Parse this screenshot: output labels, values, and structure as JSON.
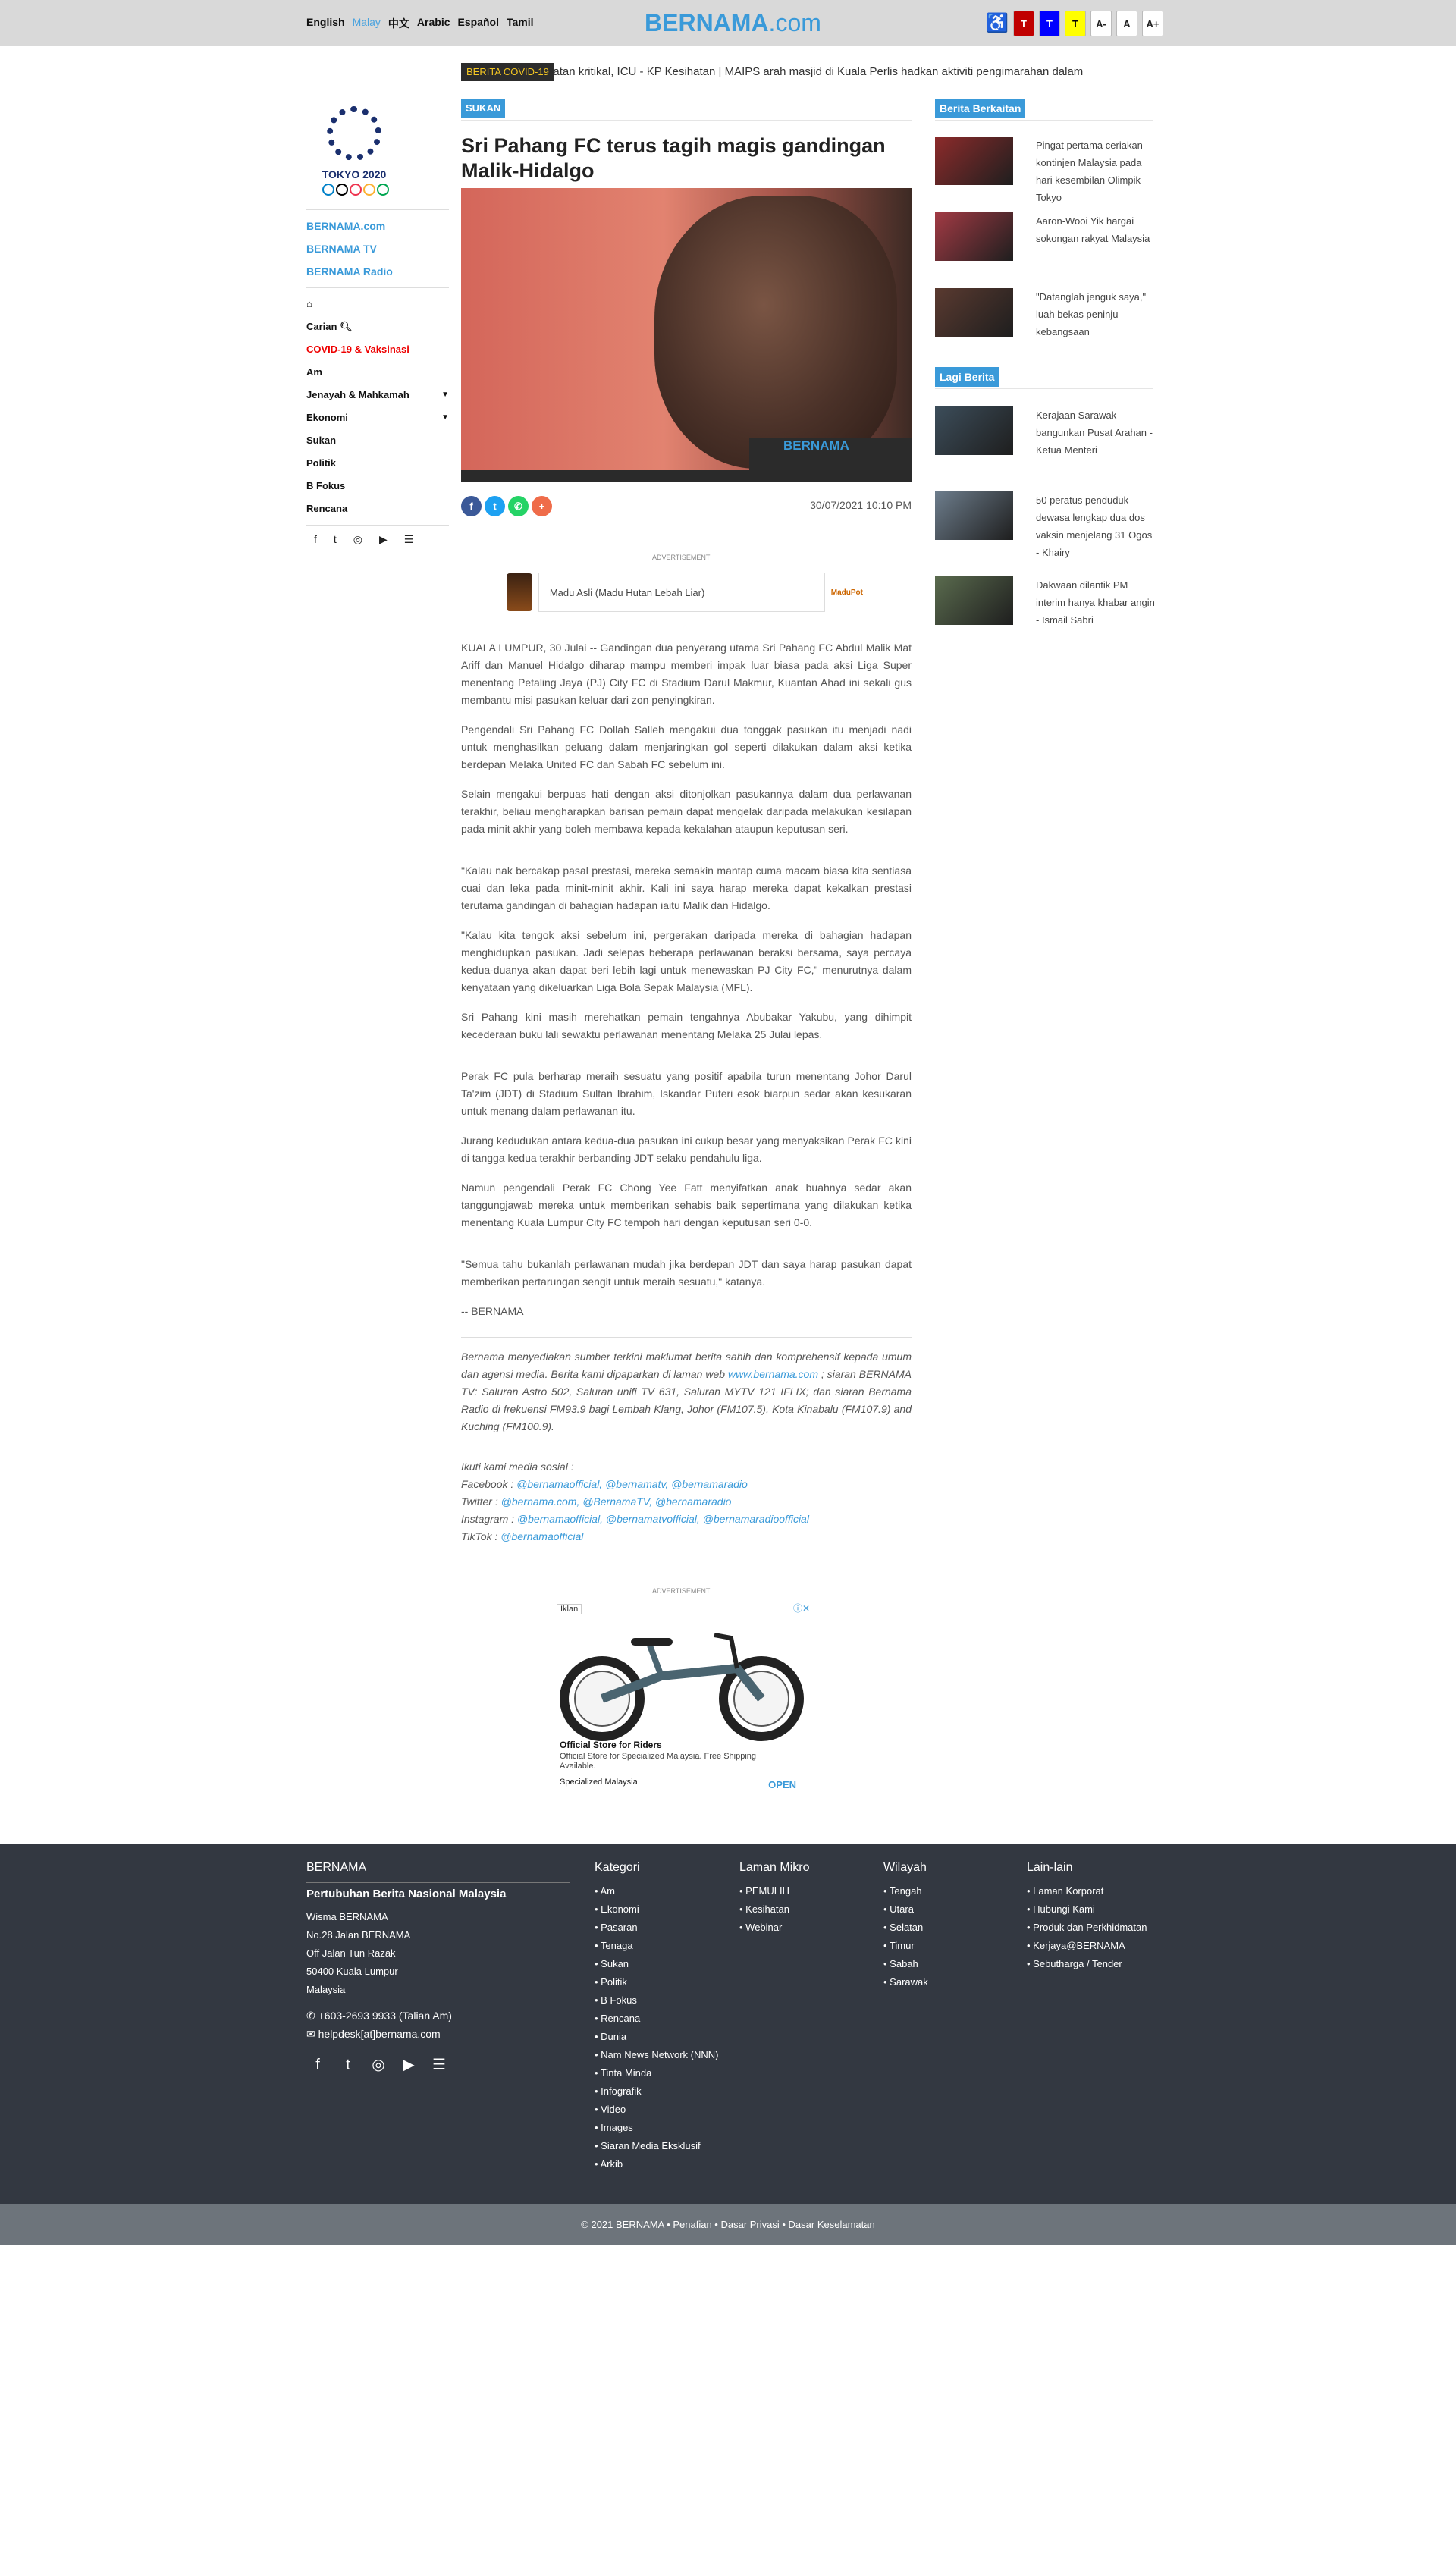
{
  "header": {
    "languages": [
      "English",
      "Malay",
      "中文",
      "Arabic",
      "Español",
      "Tamil"
    ],
    "active_language": "Malay",
    "logo_main": "BERNAMA",
    "logo_suffix": ".com",
    "accessibility_icon": "wheelchair-icon",
    "contrast_buttons": [
      "T",
      "T",
      "T"
    ],
    "contrast_colors": [
      "#c00000",
      "#0000ff",
      "#ffff00"
    ],
    "font_buttons": [
      "A-",
      "A",
      "A+"
    ]
  },
  "ticker": {
    "label": "BERITA COVID-19",
    "text": "erlu rawatan kritikal, ICU - KP Kesihatan  |  MAIPS arah masjid di Kuala Perlis hadkan aktiviti pengimarahan dalam"
  },
  "sidebar": {
    "logo_text": "TOKYO 2020",
    "links": [
      "BERNAMA.com",
      "BERNAMA TV",
      "BERNAMA Radio"
    ],
    "home_icon": "home-icon",
    "search_label": "Carian",
    "search_icon": "search-icon",
    "items": [
      {
        "label": "COVID-19 & Vaksinasi",
        "red": true,
        "caret": false
      },
      {
        "label": "Am",
        "caret": false
      },
      {
        "label": "Jenayah & Mahkamah",
        "caret": true
      },
      {
        "label": "Ekonomi",
        "caret": true
      },
      {
        "label": "Sukan",
        "caret": false
      },
      {
        "label": "Politik",
        "caret": false
      },
      {
        "label": "B Fokus",
        "caret": false
      },
      {
        "label": "Rencana",
        "caret": false
      }
    ],
    "social_icons": [
      "facebook-icon",
      "twitter-icon",
      "instagram-icon",
      "youtube-icon",
      "rss-icon"
    ]
  },
  "article": {
    "section": "SUKAN",
    "headline": "Sri Pahang FC terus tagih magis gandingan Malik-Hidalgo",
    "image_watermark": "BERNAMA",
    "datetime": "30/07/2021 10:10 PM",
    "share_icons": [
      "facebook-icon",
      "twitter-icon",
      "whatsapp-icon",
      "plus-icon"
    ],
    "paragraphs": [
      "KUALA LUMPUR, 30 Julai -- Gandingan dua penyerang utama Sri Pahang FC Abdul Malik Mat Ariff dan Manuel Hidalgo diharap mampu memberi impak luar biasa pada aksi Liga Super menentang Petaling Jaya (PJ) City FC di Stadium Darul Makmur, Kuantan Ahad ini sekali gus membantu misi pasukan keluar dari zon penyingkiran.",
      "Pengendali Sri Pahang FC Dollah Salleh mengakui dua tonggak pasukan itu menjadi nadi untuk menghasilkan peluang dalam menjaringkan gol seperti dilakukan dalam aksi ketika berdepan Melaka United FC dan Sabah FC sebelum ini.",
      "Selain mengakui berpuas hati dengan aksi ditonjolkan pasukannya dalam dua perlawanan terakhir, beliau mengharapkan barisan pemain dapat mengelak daripada melakukan kesilapan pada minit akhir yang boleh membawa kepada kekalahan ataupun keputusan seri.",
      "\"Kalau nak bercakap pasal prestasi, mereka semakin mantap cuma macam biasa kita sentiasa cuai dan leka pada minit-minit akhir. Kali ini saya harap mereka dapat kekalkan prestasi terutama gandingan di bahagian hadapan iaitu Malik dan Hidalgo.",
      "\"Kalau kita tengok aksi sebelum ini, pergerakan daripada mereka di bahagian hadapan menghidupkan pasukan. Jadi selepas beberapa perlawanan beraksi bersama, saya percaya kedua-duanya akan dapat beri lebih lagi untuk menewaskan PJ City FC,\" menurutnya dalam kenyataan yang dikeluarkan Liga Bola Sepak Malaysia (MFL).",
      "Sri Pahang kini masih merehatkan pemain tengahnya Abubakar Yakubu, yang dihimpit kecederaan buku lali sewaktu perlawanan menentang Melaka 25 Julai lepas.",
      "Perak FC pula berharap meraih sesuatu yang positif apabila turun menentang Johor Darul Ta'zim (JDT) di Stadium Sultan Ibrahim, Iskandar Puteri esok biarpun sedar akan kesukaran untuk menang dalam perlawanan itu.",
      "Jurang kedudukan antara kedua-dua pasukan ini cukup besar yang menyaksikan Perak FC kini di tangga kedua terakhir berbanding JDT selaku pendahulu liga.",
      "Namun pengendali Perak FC Chong Yee Fatt menyifatkan anak buahnya sedar akan tanggungjawab mereka untuk memberikan sehabis baik sepertimana yang dilakukan ketika menentang Kuala Lumpur City FC tempoh hari dengan keputusan seri 0-0.",
      "\"Semua tahu bukanlah perlawanan mudah jika berdepan JDT dan saya harap pasukan dapat memberikan pertarungan sengit untuk meraih sesuatu,\" katanya.",
      "-- BERNAMA"
    ],
    "disclaimer_a": "Bernama menyediakan sumber terkini maklumat berita sahih dan komprehensif kepada umum dan agensi media. Berita kami dipaparkan di laman web ",
    "disclaimer_link": "www.bernama.com",
    "disclaimer_b": " ; siaran BERNAMA TV: Saluran Astro 502, Saluran unifi TV 631, Saluran MYTV 121 IFLIX; dan siaran Bernama Radio di frekuensi FM93.9 bagi Lembah Klang, Johor (FM107.5), Kota Kinabalu (FM107.9) and Kuching (FM100.9).",
    "follow_title": "Ikuti kami media sosial :",
    "follow": [
      {
        "label": "Facebook : ",
        "handles": "@bernamaofficial, @bernamatv, @bernamaradio"
      },
      {
        "label": "Twitter : ",
        "handles": "@bernama.com, @BernamaTV, @bernamaradio"
      },
      {
        "label": "Instagram : ",
        "handles": "@bernamaofficial, @bernamatvofficial, @bernamaradioofficial"
      },
      {
        "label": "TikTok : ",
        "handles": "@bernamaofficial"
      }
    ]
  },
  "ads": {
    "label": "ADVERTISEMENT",
    "ad1_text": "Madu Asli (Madu Hutan Lebah Liar)",
    "ad1_brand": "MaduPot",
    "ad2_badge": "Iklan",
    "ad2_title": "Official Store for Riders",
    "ad2_desc": "Official Store for Specialized Malaysia. Free Shipping Available.",
    "ad2_advertiser": "Specialized Malaysia",
    "ad2_cta": "OPEN"
  },
  "related": {
    "title": "Berita Berkaitan",
    "items": [
      {
        "text": "Pingat pertama ceriakan kontinjen Malaysia pada hari kesembilan Olimpik Tokyo",
        "color": "#8d2b2b"
      },
      {
        "text": "Aaron-Wooi Yik hargai sokongan rakyat Malaysia",
        "color": "#a23a44"
      },
      {
        "text": "\"Datanglah jenguk saya,\" luah bekas peninju kebangsaan",
        "color": "#5a3a30"
      }
    ]
  },
  "more": {
    "title": "Lagi Berita",
    "items": [
      {
        "text": "Kerajaan Sarawak bangunkan Pusat Arahan - Ketua Menteri",
        "color": "#3c4d5a"
      },
      {
        "text": "50 peratus penduduk dewasa lengkap dua dos vaksin menjelang 31 Ogos - Khairy",
        "color": "#6d7d8c"
      },
      {
        "text": "Dakwaan dilantik PM interim hanya khabar angin - Ismail Sabri",
        "color": "#5a6b4e"
      }
    ]
  },
  "footer": {
    "brand": "BERNAMA",
    "org": "Pertubuhan Berita Nasional Malaysia",
    "address": [
      "Wisma BERNAMA",
      "No.28 Jalan BERNAMA",
      "Off Jalan Tun Razak",
      "50400 Kuala Lumpur",
      "Malaysia"
    ],
    "phone": "+603-2693 9933 (Talian Am)",
    "email": "helpdesk[at]bernama.com",
    "social_icons": [
      "facebook-icon",
      "twitter-icon",
      "instagram-icon",
      "youtube-icon",
      "rss-icon"
    ],
    "kategori": {
      "title": "Kategori",
      "items": [
        "Am",
        "Ekonomi",
        "Pasaran",
        "Tenaga",
        "Sukan",
        "Politik",
        "B Fokus",
        "Rencana",
        "Dunia",
        "Nam News Network (NNN)",
        "Tinta Minda",
        "Infografik",
        "Video",
        "Images",
        "Siaran Media Eksklusif",
        "Arkib"
      ]
    },
    "laman": {
      "title": "Laman Mikro",
      "items": [
        "PEMULIH",
        "Kesihatan",
        "Webinar"
      ]
    },
    "wilayah": {
      "title": "Wilayah",
      "items": [
        "Tengah",
        "Utara",
        "Selatan",
        "Timur",
        "Sabah",
        "Sarawak"
      ]
    },
    "lain": {
      "title": "Lain-lain",
      "items": [
        "Laman Korporat",
        "Hubungi Kami",
        "Produk dan Perkhidmatan",
        "Kerjaya@BERNAMA",
        "Sebutharga / Tender"
      ]
    },
    "copyright": "© 2021 BERNAMA",
    "bottom_links": [
      "Penafian",
      "Dasar Privasi",
      "Dasar Keselamatan"
    ]
  }
}
